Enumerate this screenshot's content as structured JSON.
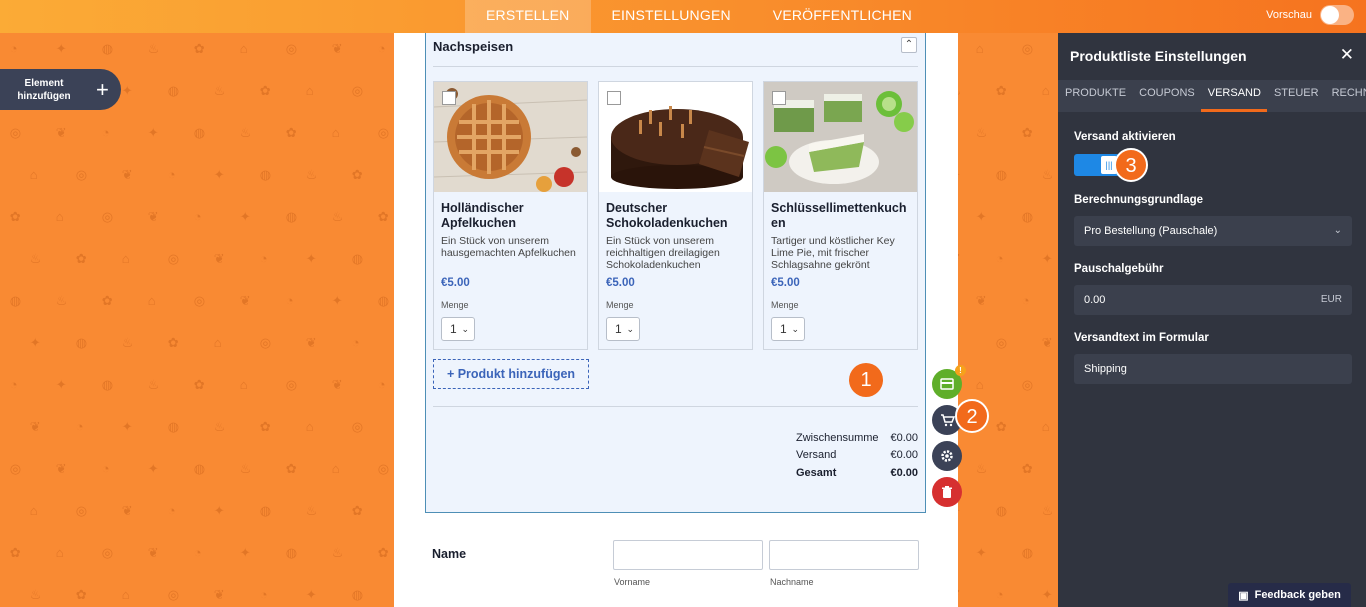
{
  "topbar": {
    "tabs": [
      {
        "label": "ERSTELLEN",
        "active": true
      },
      {
        "label": "EINSTELLUNGEN",
        "active": false
      },
      {
        "label": "VERÖFFENTLICHEN",
        "active": false
      }
    ],
    "preview_label": "Vorschau"
  },
  "add_element": {
    "label": "Element hinzufügen",
    "icon": "plus-icon"
  },
  "widget": {
    "title": "Nachspeisen",
    "products": [
      {
        "name": "Holländischer Apfelkuchen",
        "description": "Ein Stück von unserem hausgemachten Apfelkuchen",
        "price": "€5.00",
        "qty_label": "Menge",
        "qty": "1"
      },
      {
        "name": "Deutscher Schokoladenkuchen",
        "description": "Ein Stück von unserem reichhaltigen dreilagigen Schokoladenkuchen",
        "price": "€5.00",
        "qty_label": "Menge",
        "qty": "1"
      },
      {
        "name": "Schlüssellimettenkuchen",
        "description": "Tartiger und köstlicher Key Lime Pie, mit frischer Schlagsahne gekrönt",
        "price": "€5.00",
        "qty_label": "Menge",
        "qty": "1"
      }
    ],
    "add_product_label": "+ Produkt hinzufügen",
    "totals": [
      {
        "label": "Zwischensumme",
        "value": "€0.00"
      },
      {
        "label": "Versand",
        "value": "€0.00"
      },
      {
        "label": "Gesamt",
        "value": "€0.00"
      }
    ]
  },
  "steps": {
    "one": "1",
    "two": "2",
    "three": "3"
  },
  "name_field": {
    "label": "Name",
    "first": "Vorname",
    "last": "Nachname"
  },
  "panel": {
    "title": "Produktliste Einstellungen",
    "tabs": [
      {
        "label": "PRODUKTE",
        "active": false
      },
      {
        "label": "COUPONS",
        "active": false
      },
      {
        "label": "VERSAND",
        "active": true
      },
      {
        "label": "STEUER",
        "active": false
      },
      {
        "label": "RECHNUNG",
        "active": false
      }
    ],
    "enable_shipping_label": "Versand aktivieren",
    "basis_label": "Berechnungsgrundlage",
    "basis_value": "Pro Bestellung (Pauschale)",
    "flat_fee_label": "Pauschalgebühr",
    "flat_fee_value": "0.00",
    "flat_fee_currency": "EUR",
    "shipping_text_label": "Versandtext im Formular",
    "shipping_text_value": "Shipping"
  },
  "feedback_label": "Feedback geben",
  "colors": {
    "accent": "#f26a1b",
    "brand_blue": "#3b64b9",
    "panel": "#30343f"
  }
}
